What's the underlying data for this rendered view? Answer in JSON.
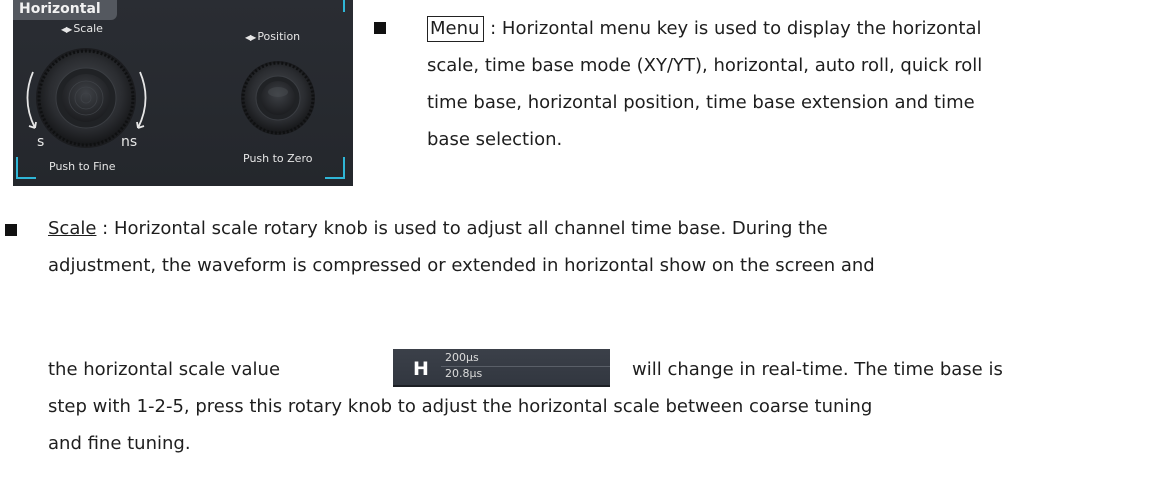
{
  "panel": {
    "title": "Horizontal",
    "scale_label": "Scale",
    "position_label": "Position",
    "s_label": "s",
    "ns_label": "ns",
    "push_fine": "Push to Fine",
    "push_zero": "Push to Zero"
  },
  "menu_item": {
    "key": "Menu",
    "line1": " : Horizontal menu key is used to display the horizontal",
    "line2": "scale, time base mode (XY/YT), horizontal, auto roll, quick roll",
    "line3": "time base, horizontal position, time base extension and time",
    "line4": "base selection."
  },
  "scale_item": {
    "key": "Scale",
    "line1": " : Horizontal scale rotary knob is used to adjust all channel time base. During the",
    "line2": "adjustment, the waveform is compressed or extended in horizontal show on the screen and",
    "line3_pre": "the horizontal scale value",
    "line3_post": "will change in real-time. The time base is",
    "line4": "step with 1-2-5, press this rotary knob to adjust the horizontal scale between coarse tuning",
    "line5": "and fine tuning."
  },
  "hscale": {
    "letter": "H",
    "value1": "200µs",
    "value2": "20.8µs"
  },
  "colors": {
    "accent": "#2fb6d6",
    "panel_bg": "#2a2d33"
  }
}
